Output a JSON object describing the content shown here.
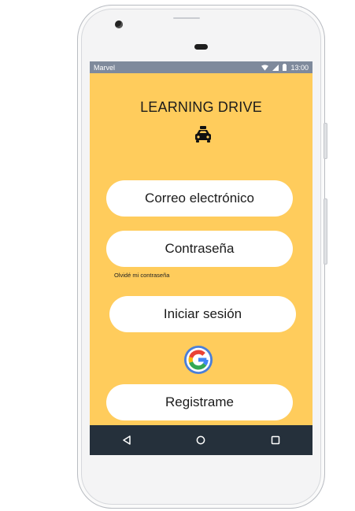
{
  "status_bar": {
    "carrier": "Marvel",
    "time": "13:00"
  },
  "app": {
    "title": "LEARNING DRIVE"
  },
  "form": {
    "email_label": "Correo electrónico",
    "password_label": "Contraseña",
    "forgot_password": "Olvidé mi contraseña",
    "login_label": "Iniciar sesión",
    "register_label": "Registrame"
  },
  "colors": {
    "background": "#ffcc5c",
    "navbar": "#25303b",
    "status_bar": "#7f8a9c"
  },
  "icons": [
    "taxi-icon",
    "google-icon",
    "back-icon",
    "home-icon",
    "recents-icon",
    "wifi-icon",
    "signal-icon",
    "battery-icon"
  ]
}
